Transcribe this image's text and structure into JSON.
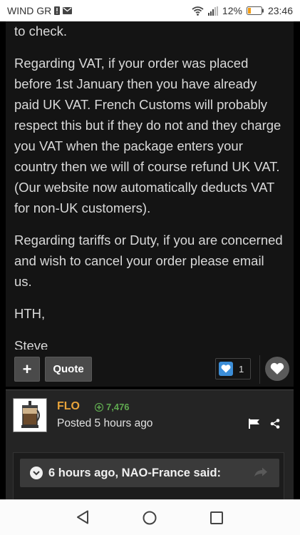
{
  "status_bar": {
    "carrier": "WIND GR",
    "battery_percent": "12%",
    "time": "23:46",
    "icons": [
      "sim-alert-icon",
      "mail-icon",
      "wifi-icon",
      "signal-icon",
      "battery-icon"
    ]
  },
  "post": {
    "paragraphs": [
      "to check.",
      "Regarding VAT, if your order was placed before 1st January then you have already paid UK VAT. French Customs will probably respect this but if they do not and they charge you VAT when the package enters your country then we will of course refund UK VAT. (Our website now automatically deducts VAT for non-UK customers).",
      "Regarding tariffs or Duty, if you are concerned and wish to cancel your order please email us.",
      "HTH,",
      "Steve"
    ],
    "actions": {
      "plus_label": "+",
      "quote_label": "Quote",
      "reaction_count": "1"
    }
  },
  "reply": {
    "author": "FLO",
    "reputation": "7,476",
    "posted": "Posted 5 hours ago",
    "quote": {
      "header": "6 hours ago, NAO-France said:"
    }
  },
  "colors": {
    "author": "#e8a33a",
    "reputation": "#5fa84f",
    "reaction_badge": "#3c8ed8",
    "battery_low": "#f39c12"
  }
}
